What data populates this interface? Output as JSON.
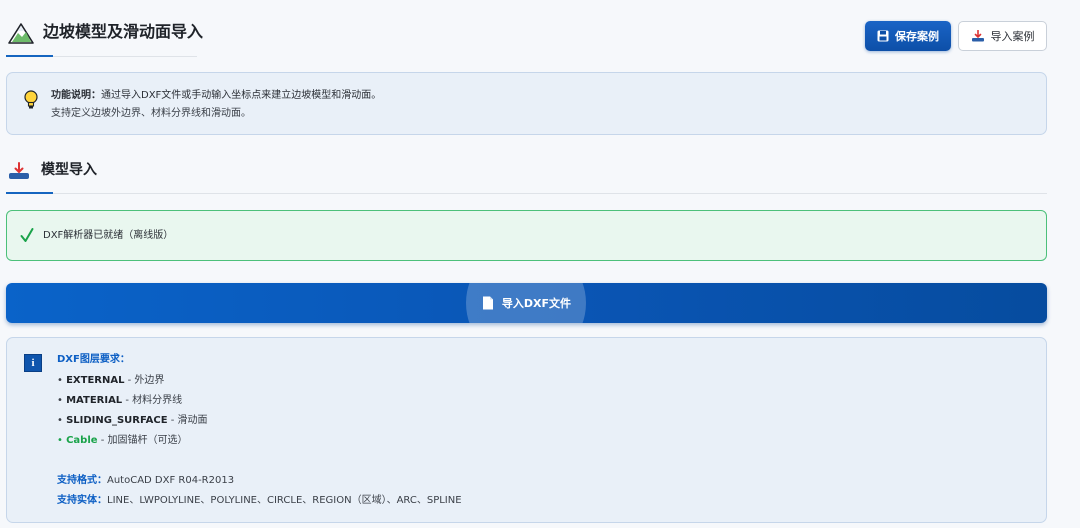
{
  "header": {
    "title": "边坡模型及滑动面导入",
    "save_label": "保存案例",
    "import_label": "导入案例"
  },
  "info": {
    "label": "功能说明：",
    "text1": "通过导入DXF文件或手动输入坐标点来建立边坡模型和滑动面。",
    "text2": "支持定义边坡外边界、材料分界线和滑动面。"
  },
  "section": {
    "title": "模型导入"
  },
  "status": {
    "text": "DXF解析器已就绪（离线版）"
  },
  "dxf_button": {
    "label": "导入DXF文件"
  },
  "requirements": {
    "title": "DXF图层要求：",
    "items": [
      {
        "bullet": "• ",
        "name": "EXTERNAL",
        "desc": " - 外边界"
      },
      {
        "bullet": "• ",
        "name": "MATERIAL",
        "desc": " - 材料分界线"
      },
      {
        "bullet": "• ",
        "name": "SLIDING_SURFACE",
        "desc": " - 滑动面"
      },
      {
        "bullet": "• ",
        "name": "Cable",
        "desc": " - 加固锚杆（可选）"
      }
    ],
    "formats_label": "支持格式：",
    "formats_value": "AutoCAD DXF R04-R2013",
    "entities_label": "支持实体：",
    "entities_value": "LINE、LWPOLYLINE、POLYLINE、CIRCLE、REGION（区域）、ARC、SPLINE"
  },
  "colors": {
    "accent": "#1565c0",
    "success": "#4cc07a",
    "cable": "#1aa34a"
  }
}
